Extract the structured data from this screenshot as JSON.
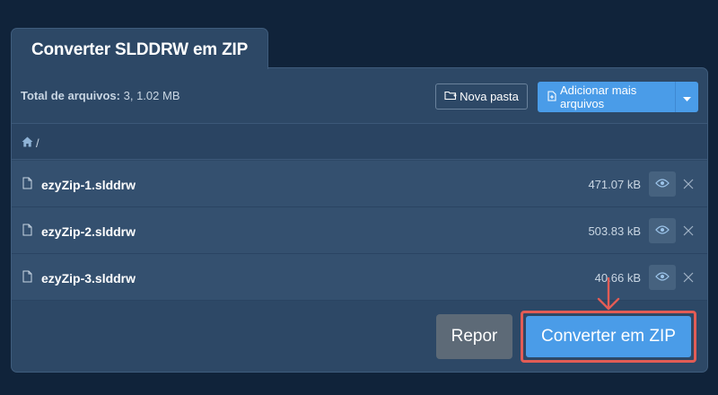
{
  "tab": {
    "title": "Converter SLDDRW em ZIP"
  },
  "toolbar": {
    "total_label": "Total de arquivos:",
    "total_value": "3, 1.02 MB",
    "new_folder_label": "Nova pasta",
    "add_files_label": "Adicionar mais arquivos"
  },
  "breadcrumb": {
    "separator": "/"
  },
  "files": [
    {
      "name": "ezyZip-1.slddrw",
      "size": "471.07 kB"
    },
    {
      "name": "ezyZip-2.slddrw",
      "size": "503.83 kB"
    },
    {
      "name": "ezyZip-3.slddrw",
      "size": "40.66 kB"
    }
  ],
  "footer": {
    "reset_label": "Repor",
    "convert_label": "Converter em ZIP"
  },
  "colors": {
    "page_bg": "#10233a",
    "panel_bg": "#2d4866",
    "row_bg": "#34506f",
    "primary": "#4a9ce8",
    "highlight": "#e25c55"
  },
  "icons": [
    "folder-plus-icon",
    "file-plus-icon",
    "caret-down-icon",
    "home-icon",
    "file-icon",
    "eye-icon",
    "close-icon",
    "arrow-down-icon"
  ]
}
